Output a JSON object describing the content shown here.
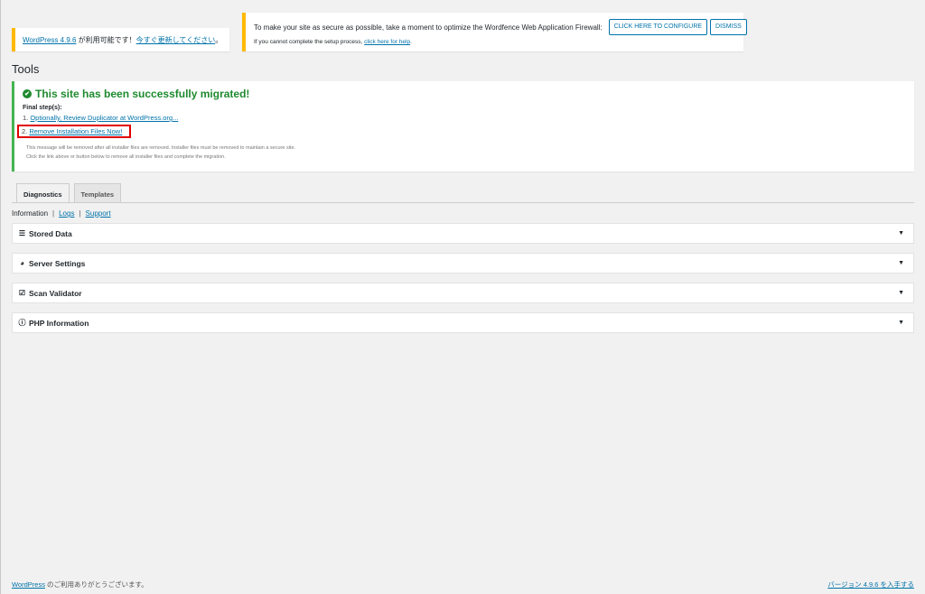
{
  "update_notice": {
    "link_version": "WordPress 4.9.6",
    "available_text": " が利用可能です！",
    "update_link": "今すぐ更新してください",
    "suffix": "。"
  },
  "wordfence_notice": {
    "message": "To make your site as secure as possible, take a moment to optimize the Wordfence Web Application Firewall:",
    "configure_label": "CLICK HERE TO CONFIGURE",
    "dismiss_label": "DISMISS",
    "help_prefix": "If you cannot complete the setup process, ",
    "help_link": "click here for help",
    "help_suffix": "."
  },
  "page": {
    "title": "Tools"
  },
  "migration": {
    "title": "This site has been successfully migrated!",
    "final_label": "Final step(s):",
    "step1_prefix": "1. ",
    "step1_link": "Optionally, Review Duplicator at WordPress.org...",
    "step2_prefix": "2. ",
    "step2_link": "Remove Installation Files Now!",
    "note1": "This message will be removed after all installer files are removed. Installer files must be removed to maintain a secure site.",
    "note2": "Click the link above or button below to remove all installer files and complete the migration."
  },
  "tabs": [
    {
      "label": "Diagnostics",
      "active": true
    },
    {
      "label": "Templates",
      "active": false
    }
  ],
  "subnav": {
    "information": "Information",
    "logs": "Logs",
    "support": "Support",
    "separator": "|"
  },
  "panels": [
    {
      "title": "Stored Data",
      "icon": "list-icon"
    },
    {
      "title": "Server Settings",
      "icon": "dashboard-icon"
    },
    {
      "title": "Scan Validator",
      "icon": "checkbox-icon"
    },
    {
      "title": "PHP Information",
      "icon": "info-circle-icon"
    }
  ],
  "footer": {
    "wp_link": "WordPress",
    "thanks": " のご利用ありがとうございます。",
    "version_link": "バージョン 4.9.6 を入手する"
  },
  "colors": {
    "notice_warning": "#ffb900",
    "success": "#46b450",
    "link": "#0073aa",
    "highlight_box": "#e00000"
  }
}
